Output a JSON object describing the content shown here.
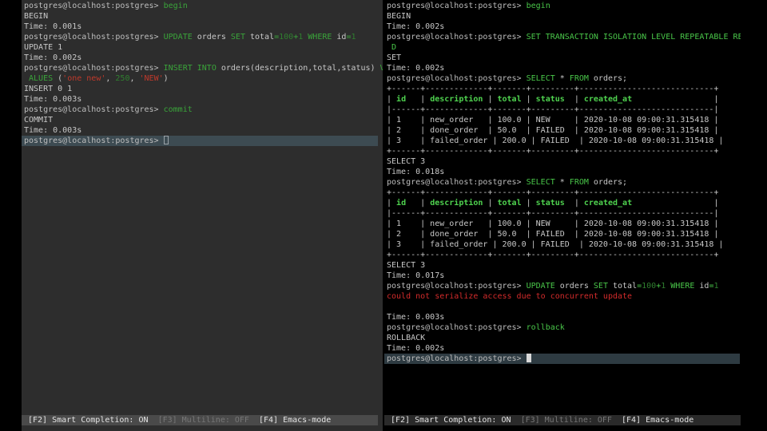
{
  "colors": {
    "background": "#000000",
    "left_pane_bg": "#2d2d2d",
    "keyword": "#3aa43a",
    "string": "#c0392b",
    "error": "#d32b2b",
    "table_header": "#4fd34f"
  },
  "left_terminal": {
    "lines": [
      [
        {
          "t": "postgres@localhost:postgres> ",
          "c": "prompt"
        },
        {
          "t": "begin",
          "c": "kw"
        }
      ],
      [
        {
          "t": "BEGIN",
          "c": "txt"
        }
      ],
      [
        {
          "t": "Time: 0.001s",
          "c": "txt"
        }
      ],
      [
        {
          "t": "postgres@localhost:postgres> ",
          "c": "prompt"
        },
        {
          "t": "UPDATE",
          "c": "kw"
        },
        {
          "t": " orders ",
          "c": "txt"
        },
        {
          "t": "SET",
          "c": "kw"
        },
        {
          "t": " total",
          "c": "txt"
        },
        {
          "t": "=",
          "c": "kw"
        },
        {
          "t": "100",
          "c": "num"
        },
        {
          "t": "+",
          "c": "kw"
        },
        {
          "t": "1",
          "c": "num"
        },
        {
          "t": " ",
          "c": "txt"
        },
        {
          "t": "WHERE",
          "c": "kw"
        },
        {
          "t": " id",
          "c": "txt"
        },
        {
          "t": "=",
          "c": "kw"
        },
        {
          "t": "1",
          "c": "num"
        }
      ],
      [
        {
          "t": "UPDATE 1",
          "c": "txt"
        }
      ],
      [
        {
          "t": "Time: 0.002s",
          "c": "txt"
        }
      ],
      [
        {
          "t": "postgres@localhost:postgres> ",
          "c": "prompt"
        },
        {
          "t": "INSERT INTO",
          "c": "kw"
        },
        {
          "t": " orders(description,total,status) ",
          "c": "txt"
        },
        {
          "t": "V",
          "c": "kw"
        }
      ],
      [
        {
          "t": " ALUES",
          "c": "kw"
        },
        {
          "t": " (",
          "c": "txt"
        },
        {
          "t": "'one new'",
          "c": "str"
        },
        {
          "t": ", ",
          "c": "txt"
        },
        {
          "t": "250",
          "c": "num"
        },
        {
          "t": ", ",
          "c": "txt"
        },
        {
          "t": "'NEW'",
          "c": "str"
        },
        {
          "t": ")",
          "c": "txt"
        }
      ],
      [
        {
          "t": "INSERT 0 1",
          "c": "txt"
        }
      ],
      [
        {
          "t": "Time: 0.003s",
          "c": "txt"
        }
      ],
      [
        {
          "t": "postgres@localhost:postgres> ",
          "c": "prompt"
        },
        {
          "t": "commit",
          "c": "kw"
        }
      ],
      [
        {
          "t": "COMMIT",
          "c": "txt"
        }
      ],
      [
        {
          "t": "Time: 0.003s",
          "c": "txt"
        }
      ],
      [
        {
          "t": "postgres@localhost:postgres> ",
          "c": "prompt"
        }
      ]
    ],
    "statusbar": [
      {
        "t": "[F2] Smart Completion: ON  ",
        "c": "sb-on"
      },
      {
        "t": "[F3] Multiline: OFF  ",
        "c": "sb-off"
      },
      {
        "t": "[F4] Emacs-mode",
        "c": "sb-on"
      }
    ]
  },
  "right_terminal": {
    "lines": [
      [
        {
          "t": "postgres@localhost:postgres> ",
          "c": "prompt"
        },
        {
          "t": "begin",
          "c": "kwb"
        }
      ],
      [
        {
          "t": "BEGIN",
          "c": "txt"
        }
      ],
      [
        {
          "t": "Time: 0.002s",
          "c": "txt"
        }
      ],
      [
        {
          "t": "postgres@localhost:postgres> ",
          "c": "prompt"
        },
        {
          "t": "SET TRANSACTION ISOLATION LEVEL REPEATABLE REA",
          "c": "kwb"
        }
      ],
      [
        {
          "t": " D",
          "c": "kwb"
        }
      ],
      [
        {
          "t": "SET",
          "c": "txt"
        }
      ],
      [
        {
          "t": "Time: 0.002s",
          "c": "txt"
        }
      ],
      [
        {
          "t": "postgres@localhost:postgres> ",
          "c": "prompt"
        },
        {
          "t": "SELECT",
          "c": "kwb"
        },
        {
          "t": " * ",
          "c": "txt"
        },
        {
          "t": "FROM",
          "c": "kwb"
        },
        {
          "t": " orders;",
          "c": "txt"
        }
      ],
      [
        {
          "t": "+------+-------------+-------+---------+----------------------------+",
          "c": "txt"
        }
      ],
      [
        {
          "t": "| ",
          "c": "txt"
        },
        {
          "t": "id",
          "c": "hdr"
        },
        {
          "t": "   | ",
          "c": "txt"
        },
        {
          "t": "description",
          "c": "hdr"
        },
        {
          "t": " | ",
          "c": "txt"
        },
        {
          "t": "total",
          "c": "hdr"
        },
        {
          "t": " | ",
          "c": "txt"
        },
        {
          "t": "status",
          "c": "hdr"
        },
        {
          "t": "  | ",
          "c": "txt"
        },
        {
          "t": "created_at",
          "c": "hdr"
        },
        {
          "t": "                 |",
          "c": "txt"
        }
      ],
      [
        {
          "t": "|------+-------------+-------+---------+----------------------------|",
          "c": "txt"
        }
      ],
      [
        {
          "t": "| 1    | new_order   | 100.0 | NEW     | 2020-10-08 09:00:31.315418 |",
          "c": "txt"
        }
      ],
      [
        {
          "t": "| 2    | done_order  | 50.0  | FAILED  | 2020-10-08 09:00:31.315418 |",
          "c": "txt"
        }
      ],
      [
        {
          "t": "| 3    | failed_order | 200.0 | FAILED  | 2020-10-08 09:00:31.315418 |",
          "c": "txt"
        }
      ],
      [
        {
          "t": "+------+-------------+-------+---------+----------------------------+",
          "c": "txt"
        }
      ],
      [
        {
          "t": "SELECT 3",
          "c": "txt"
        }
      ],
      [
        {
          "t": "Time: 0.018s",
          "c": "txt"
        }
      ],
      [
        {
          "t": "postgres@localhost:postgres> ",
          "c": "prompt"
        },
        {
          "t": "SELECT",
          "c": "kwb"
        },
        {
          "t": " * ",
          "c": "txt"
        },
        {
          "t": "FROM",
          "c": "kwb"
        },
        {
          "t": " orders;",
          "c": "txt"
        }
      ],
      [
        {
          "t": "+------+-------------+-------+---------+----------------------------+",
          "c": "txt"
        }
      ],
      [
        {
          "t": "| ",
          "c": "txt"
        },
        {
          "t": "id",
          "c": "hdr"
        },
        {
          "t": "   | ",
          "c": "txt"
        },
        {
          "t": "description",
          "c": "hdr"
        },
        {
          "t": " | ",
          "c": "txt"
        },
        {
          "t": "total",
          "c": "hdr"
        },
        {
          "t": " | ",
          "c": "txt"
        },
        {
          "t": "status",
          "c": "hdr"
        },
        {
          "t": "  | ",
          "c": "txt"
        },
        {
          "t": "created_at",
          "c": "hdr"
        },
        {
          "t": "                 |",
          "c": "txt"
        }
      ],
      [
        {
          "t": "|------+-------------+-------+---------+----------------------------|",
          "c": "txt"
        }
      ],
      [
        {
          "t": "| 1    | new_order   | 100.0 | NEW     | 2020-10-08 09:00:31.315418 |",
          "c": "txt"
        }
      ],
      [
        {
          "t": "| 2    | done_order  | 50.0  | FAILED  | 2020-10-08 09:00:31.315418 |",
          "c": "txt"
        }
      ],
      [
        {
          "t": "| 3    | failed_order | 200.0 | FAILED  | 2020-10-08 09:00:31.315418 |",
          "c": "txt"
        }
      ],
      [
        {
          "t": "+------+-------------+-------+---------+----------------------------+",
          "c": "txt"
        }
      ],
      [
        {
          "t": "SELECT 3",
          "c": "txt"
        }
      ],
      [
        {
          "t": "Time: 0.017s",
          "c": "txt"
        }
      ],
      [
        {
          "t": "postgres@localhost:postgres> ",
          "c": "prompt"
        },
        {
          "t": "UPDATE",
          "c": "kwb"
        },
        {
          "t": " orders ",
          "c": "txt"
        },
        {
          "t": "SET",
          "c": "kwb"
        },
        {
          "t": " total",
          "c": "txt"
        },
        {
          "t": "=",
          "c": "kwb"
        },
        {
          "t": "100",
          "c": "num"
        },
        {
          "t": "+",
          "c": "kwb"
        },
        {
          "t": "1",
          "c": "num"
        },
        {
          "t": " ",
          "c": "txt"
        },
        {
          "t": "WHERE",
          "c": "kwb"
        },
        {
          "t": " id",
          "c": "txt"
        },
        {
          "t": "=",
          "c": "kwb"
        },
        {
          "t": "1",
          "c": "num"
        }
      ],
      [
        {
          "t": "could not serialize access due to concurrent update",
          "c": "err"
        }
      ],
      [
        {
          "t": "",
          "c": "txt"
        }
      ],
      [
        {
          "t": "Time: 0.003s",
          "c": "txt"
        }
      ],
      [
        {
          "t": "postgres@localhost:postgres> ",
          "c": "prompt"
        },
        {
          "t": "rollback",
          "c": "kwb"
        }
      ],
      [
        {
          "t": "ROLLBACK",
          "c": "txt"
        }
      ],
      [
        {
          "t": "Time: 0.002s",
          "c": "txt"
        }
      ],
      [
        {
          "t": "postgres@localhost:postgres> ",
          "c": "prompt"
        }
      ]
    ],
    "statusbar": [
      {
        "t": "[F2] Smart Completion: ON  ",
        "c": "sb-on"
      },
      {
        "t": "[F3] Multiline: OFF  ",
        "c": "sb-off"
      },
      {
        "t": "[F4] Emacs-mode",
        "c": "sb-on"
      }
    ]
  }
}
